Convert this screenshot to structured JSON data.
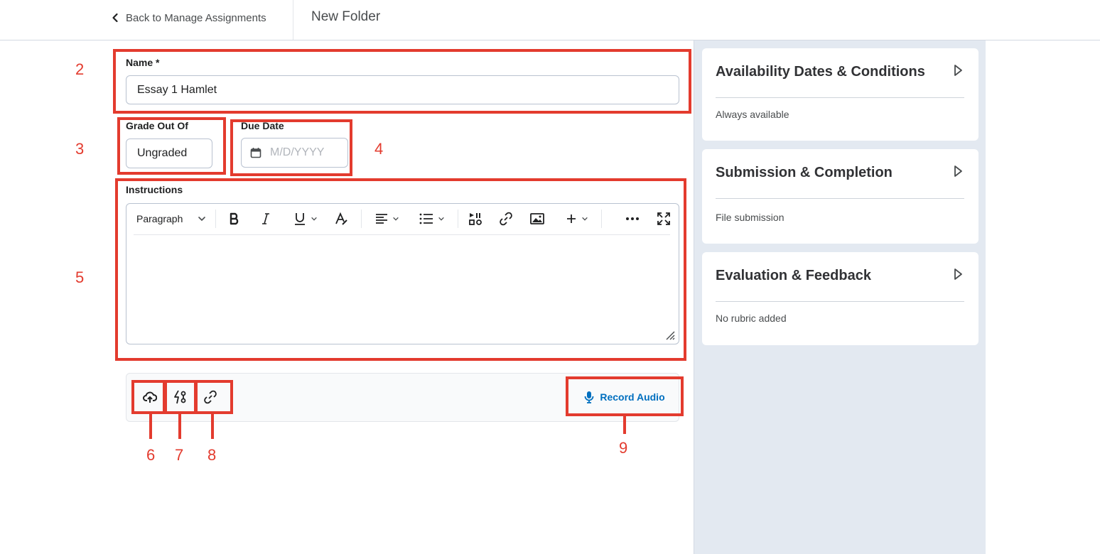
{
  "header": {
    "back_label": "Back to Manage Assignments",
    "title": "New Folder"
  },
  "form": {
    "name_label": "Name *",
    "name_value": "Essay 1 Hamlet",
    "grade_label": "Grade Out Of",
    "grade_value": "Ungraded",
    "due_label": "Due Date",
    "due_placeholder": "M/D/YYYY",
    "instructions_label": "Instructions"
  },
  "editor_toolbar": {
    "paragraph_label": "Paragraph",
    "icons": [
      "chevron-down-icon",
      "bold-icon",
      "italic-icon",
      "underline-icon",
      "text-style-icon",
      "align-icon",
      "list-icon",
      "insert-stuff-icon",
      "link-icon",
      "image-icon",
      "plus-icon",
      "more-icon",
      "fullscreen-icon"
    ]
  },
  "attachments": {
    "icons": [
      "upload-icon",
      "add-link-icon",
      "link-icon"
    ],
    "record_audio_label": "Record Audio"
  },
  "side_panel": {
    "cards": [
      {
        "title": "Availability Dates & Conditions",
        "summary": "Always available"
      },
      {
        "title": "Submission & Completion",
        "summary": "File submission"
      },
      {
        "title": "Evaluation & Feedback",
        "summary": "No rubric added"
      }
    ]
  },
  "annotations": {
    "numbers": [
      "2",
      "3",
      "4",
      "5",
      "6",
      "7",
      "8",
      "9"
    ],
    "color": "#e33b2e"
  },
  "colors": {
    "accent": "#006fbf",
    "panel_bg": "#e3e9f1"
  }
}
